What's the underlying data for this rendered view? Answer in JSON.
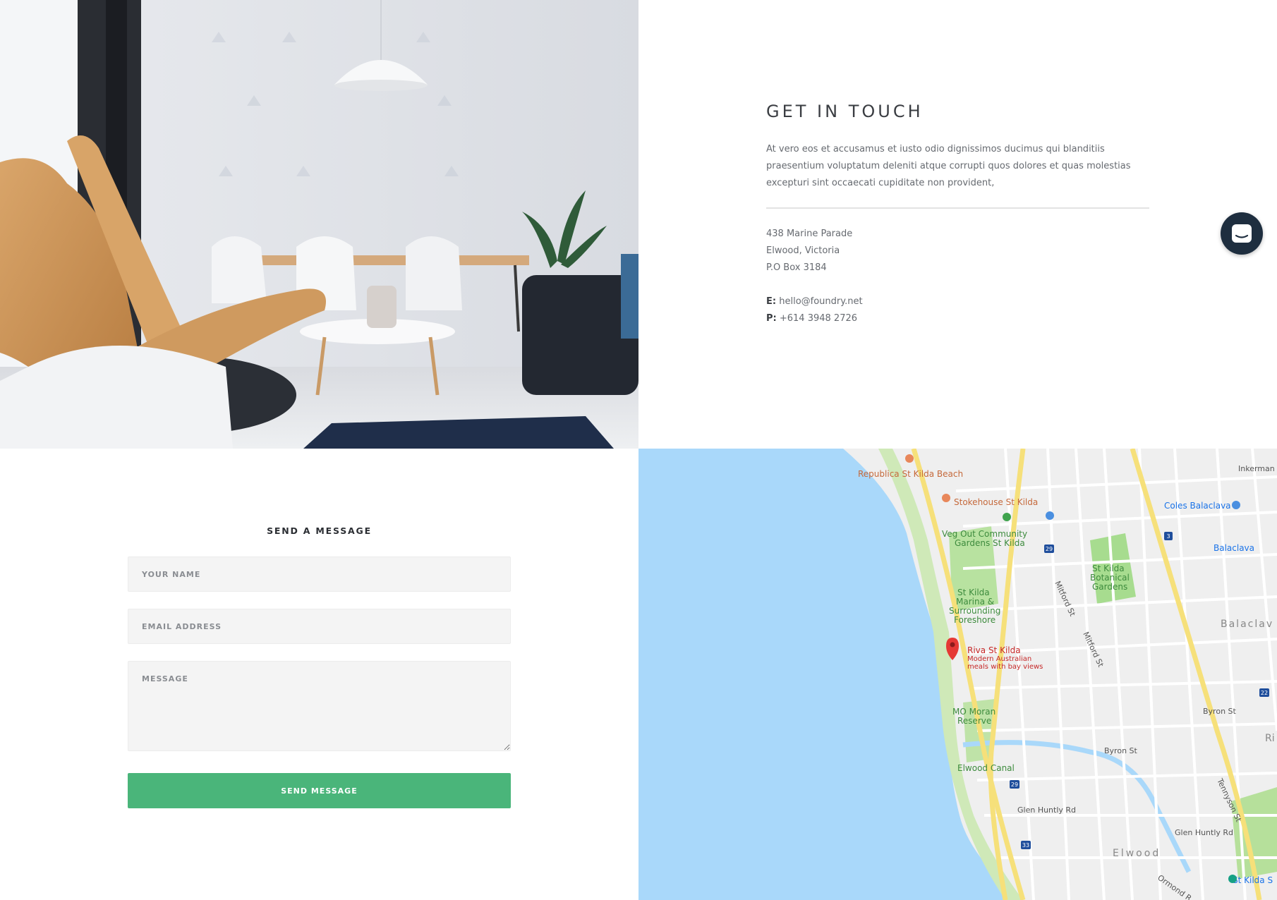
{
  "contact": {
    "title": "GET IN TOUCH",
    "lead": "At vero eos et accusamus et iusto odio dignissimos ducimus qui blanditiis praesentium voluptatum deleniti atque corrupti quos dolores et quas molestias excepturi sint occaecati cupiditate non provident,",
    "address_line1": "438 Marine Parade",
    "address_line2": "Elwood, Victoria",
    "address_line3": "P.O Box 3184",
    "email_label": "E:",
    "email_value": "hello@foundry.net",
    "phone_label": "P:",
    "phone_value": "+614 3948 2726"
  },
  "form": {
    "title": "SEND A MESSAGE",
    "name_placeholder": "YOUR NAME",
    "email_placeholder": "EMAIL ADDRESS",
    "message_placeholder": "MESSAGE",
    "submit_label": "SEND MESSAGE"
  },
  "map": {
    "labels": {
      "republica": "Republica St Kilda Beach",
      "stokehouse": "Stokehouse St Kilda",
      "vegout1": "Veg Out Community",
      "vegout2": "Gardens St Kilda",
      "botanical1": "St Kilda",
      "botanical2": "Botanical",
      "botanical3": "Gardens",
      "marina1": "St Kilda",
      "marina2": "Marina &",
      "marina3": "Surrounding",
      "marina4": "Foreshore",
      "riva_title": "Riva St Kilda",
      "riva_desc1": "Modern Australian",
      "riva_desc2": "meals with bay views",
      "moran1": "MO Moran",
      "moran2": "Reserve",
      "elwood_canal": "Elwood Canal",
      "glen_huntly_1": "Glen Huntly Rd",
      "glen_huntly_2": "Glen Huntly Rd",
      "elwood": "Elwood",
      "coles": "Coles Balaclava",
      "balaclava_station": "Balaclava",
      "balaclava_area": "Balaclav",
      "inkerman": "Inkerman",
      "mitford1": "Mitford St",
      "mitford2": "Mitford St",
      "byron1": "Byron St",
      "byron2": "Byron St",
      "tennyson": "Tennyson St",
      "ormond": "Ormond R",
      "st_kilda_s": "St Kilda S",
      "ri": "Ri",
      "route29a": "29",
      "route29b": "29",
      "route3": "3",
      "route22": "22",
      "route33": "33"
    }
  }
}
